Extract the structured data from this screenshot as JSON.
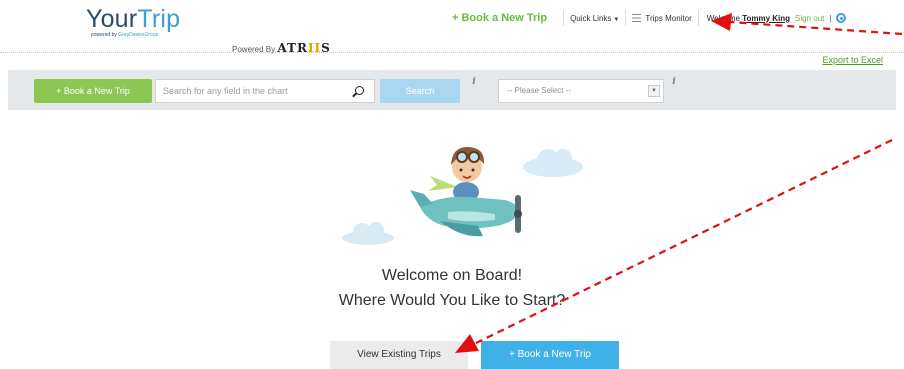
{
  "brand": {
    "logo_your": "Your",
    "logo_trip": "Trip",
    "logo_sub_prefix": "powered by ",
    "logo_sub_brand": "GrayDawesGroup",
    "powered_by": "Powered By",
    "atriis_a": "ATR",
    "atriis_i": "II",
    "atriis_s": "S"
  },
  "topnav": {
    "book_new_trip": "+ Book a New Trip",
    "quick_links": "Quick Links",
    "trips_monitor": "Trips Monitor",
    "welcome_prefix": "Welcome ",
    "user_name": "Tommy King",
    "sign_out": "Sign out",
    "separator": "|"
  },
  "export_to_excel": "Export to Excel",
  "toolbar": {
    "book_new_trip": "+ Book a New Trip",
    "search_placeholder": "Search for any field in the chart",
    "search_button": "Search",
    "info_symbol": "i",
    "select_value": "-- Please Select --"
  },
  "main": {
    "welcome_line1": "Welcome on Board!",
    "welcome_line2": "Where Would You Like to Start?",
    "view_existing": "View Existing Trips",
    "book_new_trip": "+ Book a New Trip"
  },
  "colors": {
    "brand_green": "#6bba3b",
    "brand_blue": "#3aa0d4",
    "primary_button": "#3fb0e8",
    "annotation_arrow": "#e01010"
  }
}
